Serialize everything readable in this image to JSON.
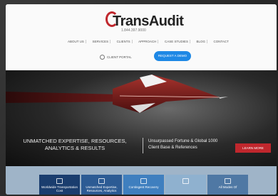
{
  "brand": {
    "name": "TransAudit",
    "phone": "1.844.397.9000"
  },
  "nav": {
    "items": [
      "ABOUT US",
      "SERVICES",
      "CLIENTS",
      "APPROACH",
      "CASE STUDIES",
      "BLOG",
      "CONTACT"
    ]
  },
  "header": {
    "portal_label": "CLIENT PORTAL",
    "demo_button": "REQUEST A DEMO"
  },
  "hero": {
    "headline": "UNMATCHED EXPERTISE, RESOURCES, ANALYTICS & RESULTS",
    "subline": "Unsurpassed Fortune & Global 1000 Client Base & References",
    "cta": "LEARN MORE"
  },
  "tiles": [
    {
      "label": "Worldwide Transportation Cost",
      "color": "#1a3d6e"
    },
    {
      "label": "Unmatched Expertise, Resources, Analytics",
      "color": "#2c5b94"
    },
    {
      "label": "Contingent Recovery",
      "color": "#3f7fbf"
    },
    {
      "label": "",
      "color": "#8fb1cf"
    },
    {
      "label": "All Modes Of",
      "color": "#4f78a4"
    }
  ],
  "colors": {
    "brand_red": "#c0272d",
    "accent_blue": "#1e88e5"
  }
}
